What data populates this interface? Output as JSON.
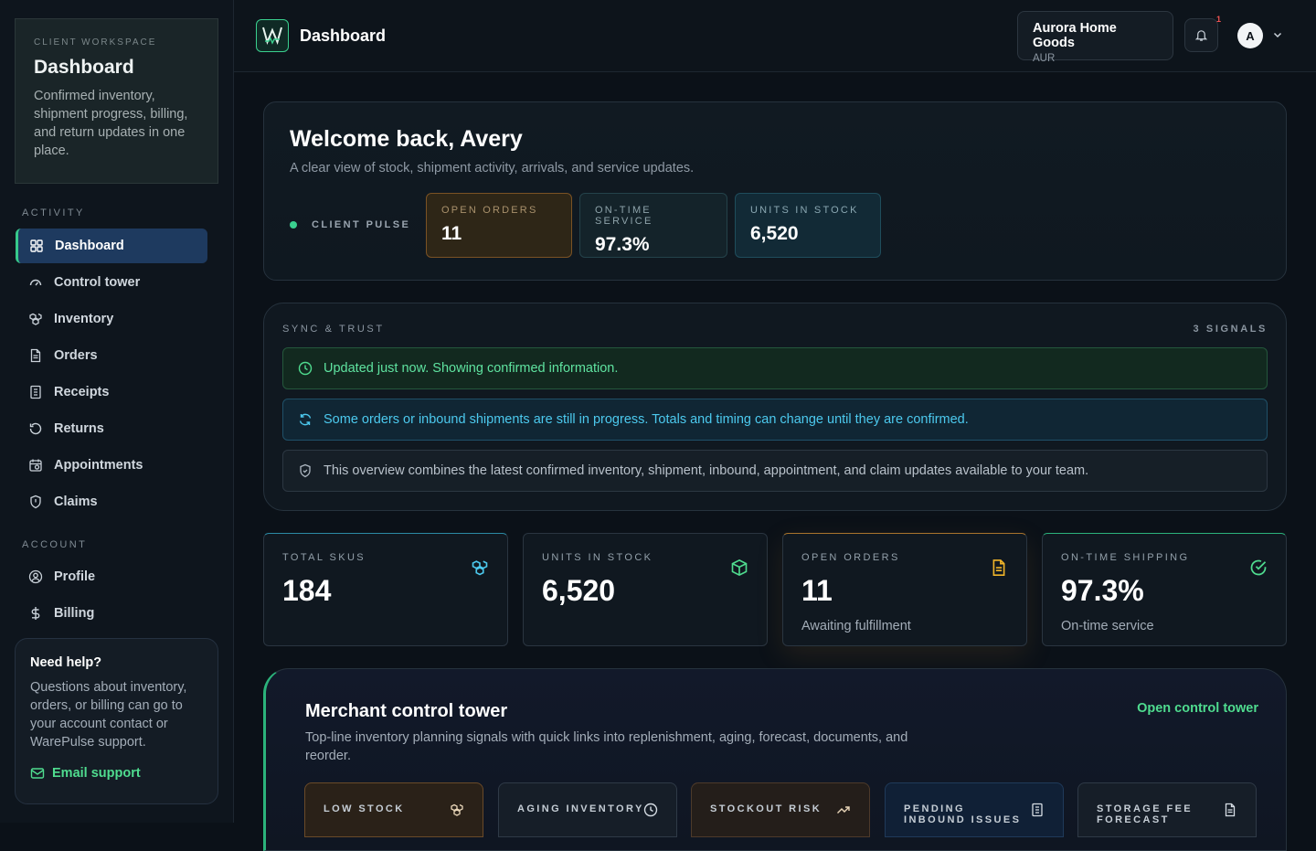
{
  "sidebar": {
    "workspace": {
      "kicker": "CLIENT WORKSPACE",
      "title": "Dashboard",
      "description": "Confirmed inventory, shipment progress, billing, and return updates in one place."
    },
    "activity_label": "ACTIVITY",
    "activity_items": [
      {
        "label": "Dashboard",
        "icon": "grid-icon",
        "active": true
      },
      {
        "label": "Control tower",
        "icon": "gauge-icon"
      },
      {
        "label": "Inventory",
        "icon": "boxes-icon"
      },
      {
        "label": "Orders",
        "icon": "document-icon"
      },
      {
        "label": "Receipts",
        "icon": "receipt-icon"
      },
      {
        "label": "Returns",
        "icon": "rotate-ccw-icon"
      },
      {
        "label": "Appointments",
        "icon": "calendar-icon"
      },
      {
        "label": "Claims",
        "icon": "shield-icon"
      }
    ],
    "account_label": "ACCOUNT",
    "account_items": [
      {
        "label": "Profile",
        "icon": "user-circle-icon"
      },
      {
        "label": "Billing",
        "icon": "dollar-icon"
      }
    ],
    "help": {
      "title": "Need help?",
      "description": "Questions about inventory, orders, or billing can go to your account contact or WarePulse support.",
      "link_label": "Email support"
    }
  },
  "topbar": {
    "title": "Dashboard",
    "org_name": "Aurora Home Goods",
    "org_code": "AUR",
    "notification_count": "1",
    "avatar_initial": "A"
  },
  "hero": {
    "title": "Welcome back, Avery",
    "subtitle": "A clear view of stock, shipment activity, arrivals, and service updates.",
    "pulse_label": "CLIENT PULSE",
    "chips": [
      {
        "label": "OPEN ORDERS",
        "value": "11"
      },
      {
        "label": "ON-TIME SERVICE",
        "value": "97.3%"
      },
      {
        "label": "UNITS IN STOCK",
        "value": "6,520"
      }
    ]
  },
  "sync": {
    "kicker": "SYNC & TRUST",
    "count": "3 SIGNALS",
    "banners": [
      {
        "text": "Updated just now. Showing confirmed information.",
        "icon": "clock-icon"
      },
      {
        "text": "Some orders or inbound shipments are still in progress. Totals and timing can change until they are confirmed.",
        "icon": "refresh-icon"
      },
      {
        "text": "This overview combines the latest confirmed inventory, shipment, inbound, appointment, and claim updates available to your team.",
        "icon": "shield-icon"
      }
    ]
  },
  "kpis": [
    {
      "label": "TOTAL SKUS",
      "value": "184",
      "sub": "",
      "icon": "boxes-icon"
    },
    {
      "label": "UNITS IN STOCK",
      "value": "6,520",
      "sub": "",
      "icon": "package-icon"
    },
    {
      "label": "OPEN ORDERS",
      "value": "11",
      "sub": "Awaiting fulfillment",
      "icon": "document-icon"
    },
    {
      "label": "ON-TIME SHIPPING",
      "value": "97.3%",
      "sub": "On-time service",
      "icon": "check-circle-icon"
    }
  ],
  "tower": {
    "title": "Merchant control tower",
    "description": "Top-line inventory planning signals with quick links into replenishment, aging, forecast, documents, and reorder.",
    "link_label": "Open control tower",
    "cards": [
      {
        "label": "LOW STOCK",
        "icon": "boxes-icon"
      },
      {
        "label": "AGING INVENTORY",
        "icon": "clock-icon"
      },
      {
        "label": "STOCKOUT RISK",
        "icon": "trend-up-icon"
      },
      {
        "label": "PENDING INBOUND ISSUES",
        "icon": "receipt-icon"
      },
      {
        "label": "STORAGE FEE FORECAST",
        "icon": "document-icon"
      }
    ]
  },
  "colors": {
    "accent_green": "#3ad08f",
    "active_nav": "#1e3a5f",
    "orange_chip": "#3a2a17",
    "teal_chip": "#12303a"
  }
}
